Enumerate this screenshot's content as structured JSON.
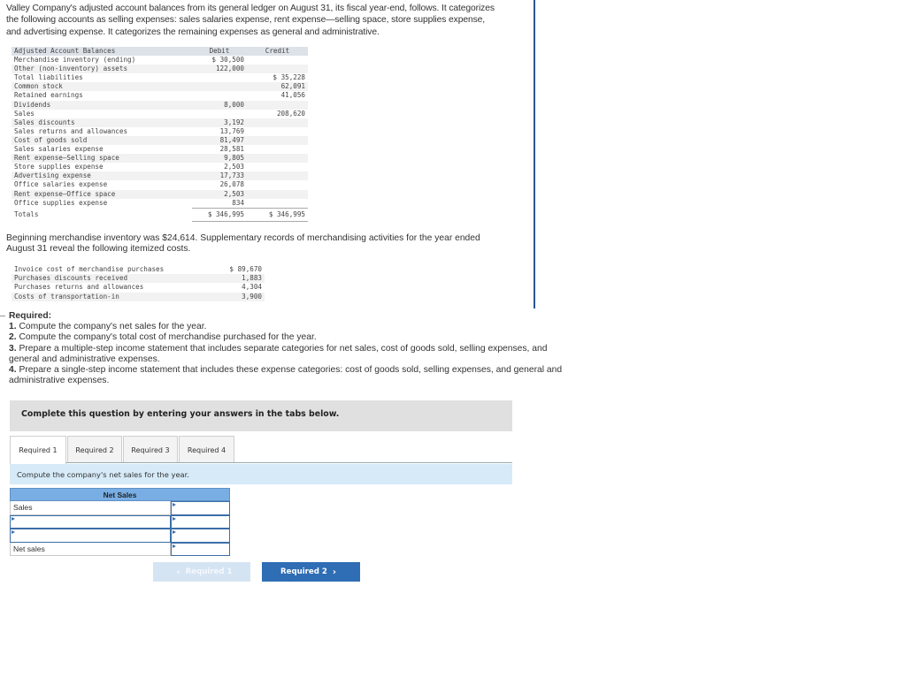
{
  "intro": "Valley Company's adjusted account balances from its general ledger on August 31, its fiscal year-end, follows. It categorizes the following accounts as selling expenses: sales salaries expense, rent expense—selling space, store supplies expense, and advertising expense. It categorizes the remaining expenses as general and administrative.",
  "ledger": {
    "headers": {
      "account": "Adjusted Account Balances",
      "debit": "Debit",
      "credit": "Credit"
    },
    "rows": [
      {
        "account": "Merchandise inventory (ending)",
        "debit": "$ 30,500",
        "credit": ""
      },
      {
        "account": "Other (non-inventory) assets",
        "debit": "122,000",
        "credit": ""
      },
      {
        "account": "Total liabilities",
        "debit": "",
        "credit": "$ 35,228"
      },
      {
        "account": "Common stock",
        "debit": "",
        "credit": "62,091"
      },
      {
        "account": "Retained earnings",
        "debit": "",
        "credit": "41,056"
      },
      {
        "account": "Dividends",
        "debit": "8,000",
        "credit": ""
      },
      {
        "account": "Sales",
        "debit": "",
        "credit": "208,620"
      },
      {
        "account": "Sales discounts",
        "debit": "3,192",
        "credit": ""
      },
      {
        "account": "Sales returns and allowances",
        "debit": "13,769",
        "credit": ""
      },
      {
        "account": "Cost of goods sold",
        "debit": "81,497",
        "credit": ""
      },
      {
        "account": "Sales salaries expense",
        "debit": "28,581",
        "credit": ""
      },
      {
        "account": "Rent expense—Selling space",
        "debit": "9,805",
        "credit": ""
      },
      {
        "account": "Store supplies expense",
        "debit": "2,503",
        "credit": ""
      },
      {
        "account": "Advertising expense",
        "debit": "17,733",
        "credit": ""
      },
      {
        "account": "Office salaries expense",
        "debit": "26,078",
        "credit": ""
      },
      {
        "account": "Rent expense—Office space",
        "debit": "2,503",
        "credit": ""
      },
      {
        "account": "Office supplies expense",
        "debit": "834",
        "credit": ""
      }
    ],
    "totals": {
      "label": "Totals",
      "debit": "$ 346,995",
      "credit": "$ 346,995"
    }
  },
  "paragraph2": "Beginning merchandise inventory was $24,614. Supplementary records of merchandising activities for the year ended August 31 reveal the following itemized costs.",
  "purchases": [
    {
      "label": "Invoice cost of merchandise purchases",
      "value": "$ 89,670"
    },
    {
      "label": "Purchases discounts received",
      "value": "1,883"
    },
    {
      "label": "Purchases returns and allowances",
      "value": "4,304"
    },
    {
      "label": "Costs of transportation-in",
      "value": "3,900"
    }
  ],
  "required": {
    "title": "Required:",
    "items": [
      {
        "num": "1.",
        "text": " Compute the company's net sales for the year."
      },
      {
        "num": "2.",
        "text": " Compute the company's total cost of merchandise purchased for the year."
      },
      {
        "num": "3.",
        "text": " Prepare a multiple-step income statement that includes separate categories for net sales, cost of goods sold, selling expenses, and general and administrative expenses."
      },
      {
        "num": "4.",
        "text": " Prepare a single-step income statement that includes these expense categories: cost of goods sold, selling expenses, and general and administrative expenses."
      }
    ]
  },
  "complete_bar": "Complete this question by entering your answers in the tabs below.",
  "tabs": [
    {
      "label": "Required 1",
      "active": true
    },
    {
      "label": "Required 2",
      "active": false
    },
    {
      "label": "Required 3",
      "active": false
    },
    {
      "label": "Required 4",
      "active": false
    }
  ],
  "instruction": "Compute the company's net sales for the year.",
  "net_sales_table": {
    "title": "Net Sales",
    "rows": [
      {
        "label": "Sales",
        "label_editable": false,
        "value": ""
      },
      {
        "label": "",
        "label_editable": true,
        "value": ""
      },
      {
        "label": "",
        "label_editable": true,
        "value": ""
      },
      {
        "label": "Net sales",
        "label_editable": false,
        "value": ""
      }
    ]
  },
  "nav": {
    "prev_label": "Required 1",
    "next_label": "Required 2",
    "prev_icon": "chevron-left-icon",
    "next_icon": "chevron-right-icon"
  },
  "colors": {
    "accent": "#2f6db5",
    "table_header": "#79aee4",
    "instruction_bg": "#d6eaf8",
    "divider_line": "#2a5593"
  }
}
